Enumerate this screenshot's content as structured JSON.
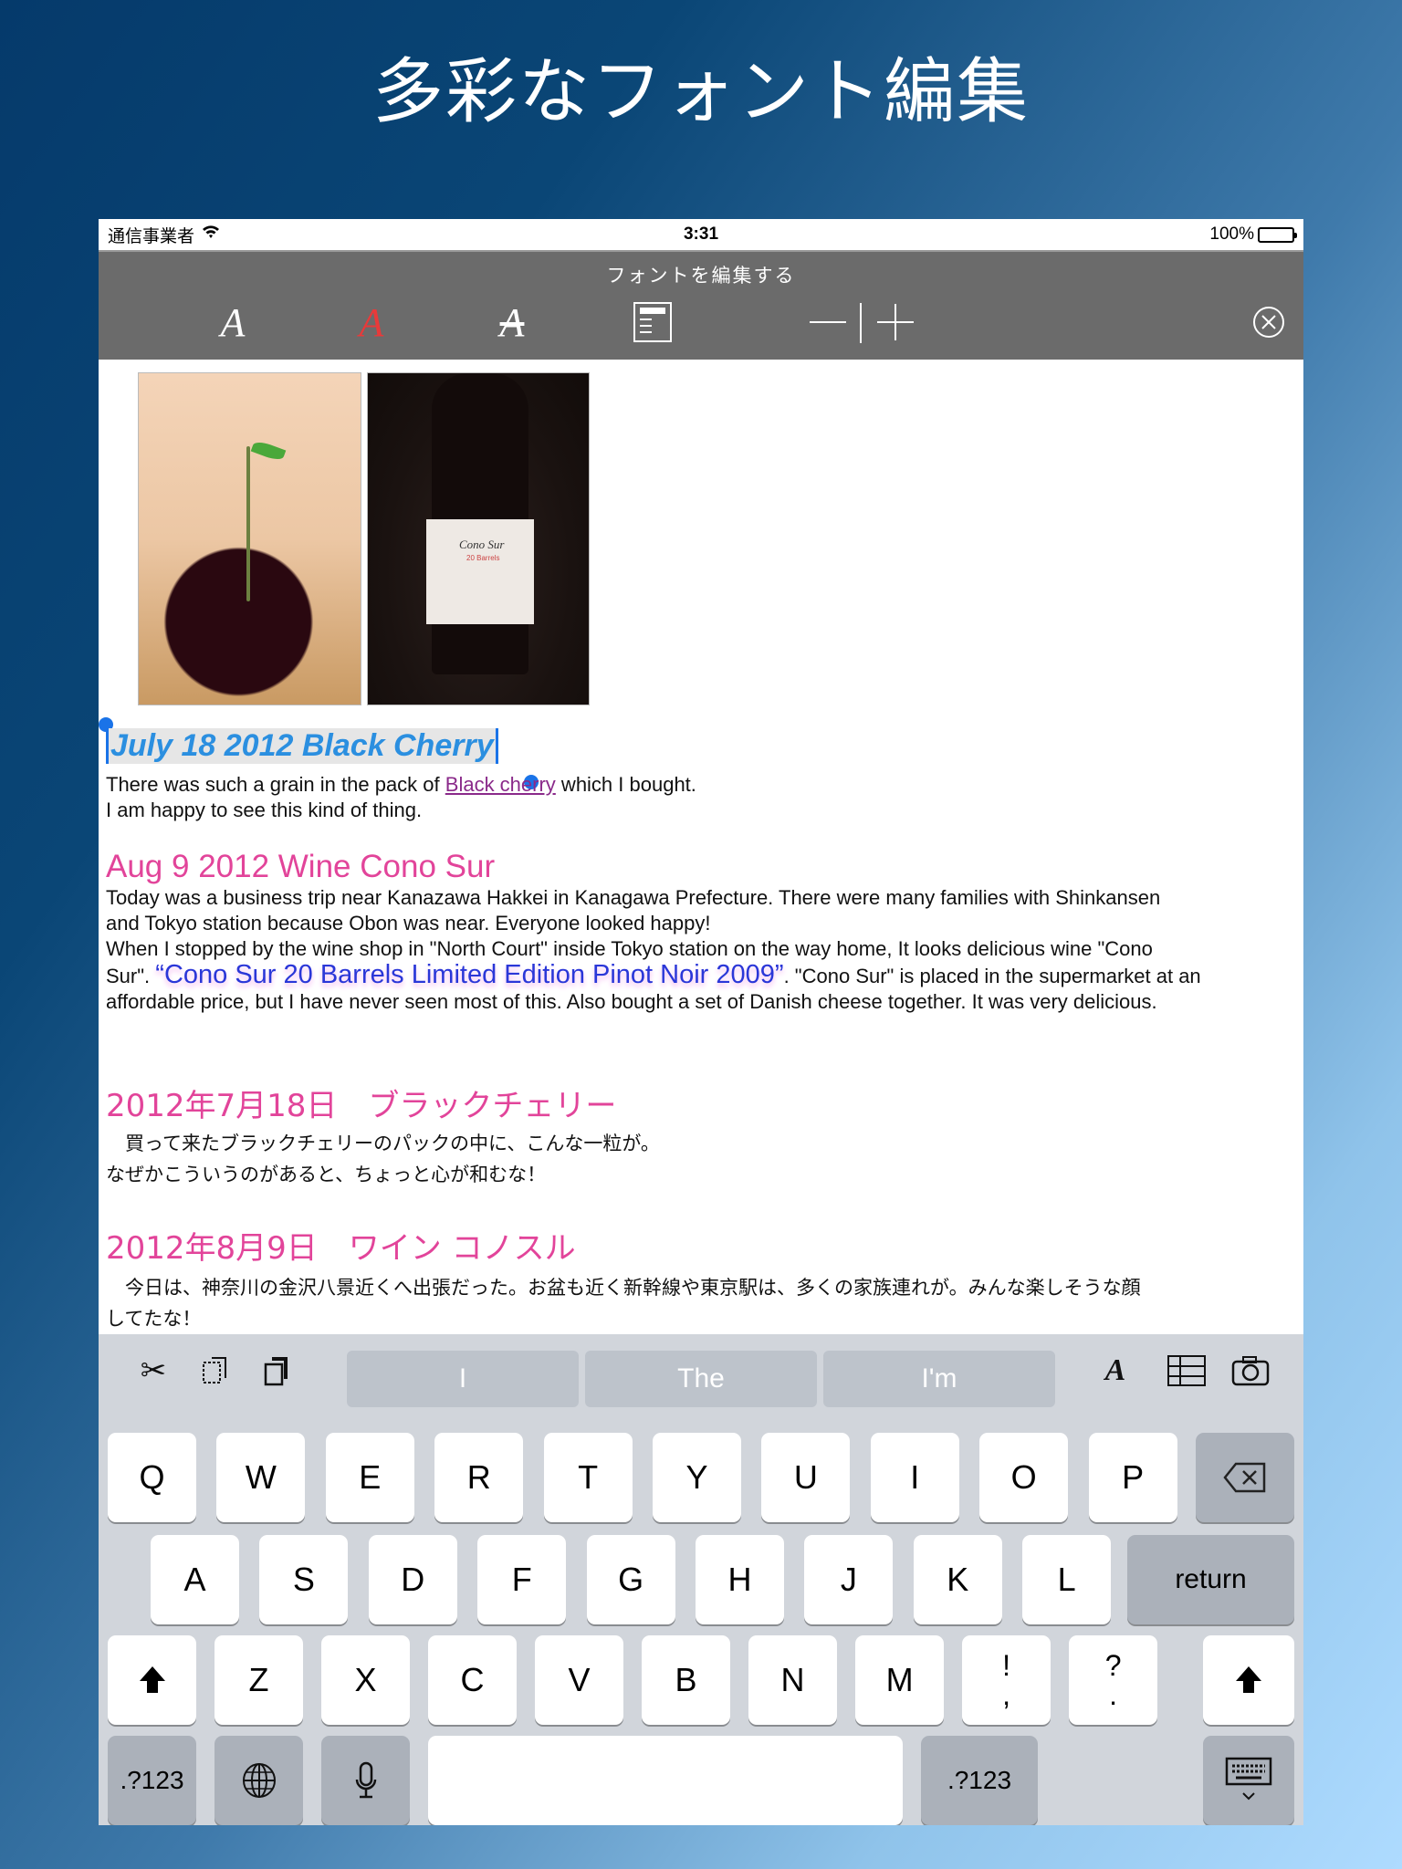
{
  "headline": "多彩なフォント編集",
  "status_bar": {
    "carrier": "通信事業者",
    "time": "3:31",
    "battery": "100%",
    "icons": [
      "wifi-icon",
      "battery-icon"
    ]
  },
  "toolbar": {
    "title": "フォントを編集する",
    "buttons": [
      {
        "name": "font-style",
        "glyph": "A"
      },
      {
        "name": "font-color",
        "glyph": "A",
        "color": "#e83a3a"
      },
      {
        "name": "strikethrough",
        "glyph": "A"
      },
      {
        "name": "align",
        "glyph": "≣"
      },
      {
        "name": "decrease-size",
        "glyph": "—"
      },
      {
        "name": "increase-size",
        "glyph": "+"
      },
      {
        "name": "close",
        "glyph": "⊗"
      }
    ]
  },
  "content": {
    "entries": [
      {
        "heading": "July 18 2012   Black Cherry",
        "heading_color": "#2b8fe0",
        "body_before_link": " There was such a grain in the pack of ",
        "link": "Black cherry",
        "body_after_link": " which I bought.",
        "body_line2": "I am happy to see this kind of thing."
      },
      {
        "heading": "Aug 9 2012   Wine Cono Sur",
        "heading_color": "#e2449a",
        "line1": " Today was a business trip near Kanazawa Hakkei in Kanagawa Prefecture. There were many families with Shinkansen",
        "line2": "and Tokyo station because Obon was near. Everyone looked happy!",
        "line3": " When I stopped by the wine shop in \"North Court\" inside Tokyo station on the way home, It looks delicious wine \"Cono",
        "line4_pre": "Sur\". ",
        "highlight": "“Cono Sur 20 Barrels Limited Edition Pinot Noir 2009”",
        "highlight_color": "#2a37d8",
        "line4_post": ". \"Cono Sur\" is placed in the supermarket at an",
        "line5": "affordable price, but I have never seen most of this. Also bought a set of Danish cheese together. It was very delicious."
      },
      {
        "heading": "2012年7月18日　ブラックチェリー",
        "line1": "　買って来たブラックチェリーのパックの中に、こんな一粒が。",
        "line2": "なぜかこういうのがあると、ちょっと心が和むな！"
      },
      {
        "heading": "2012年8月9日　ワイン コノスル",
        "line1": "　今日は、神奈川の金沢八景近くへ出張だった。お盆も近く新幹線や東京駅は、多くの家族連れが。みんな楽しそうな顔",
        "line2": "してたな！"
      }
    ],
    "photos": [
      {
        "alt": "cherry-photo"
      },
      {
        "alt": "wine-bottle-photo",
        "label": "Cono Sur",
        "sublabel": "20 Barrels"
      }
    ]
  },
  "keyboard": {
    "shortcuts_left": [
      "scissors-icon",
      "copy-icon",
      "paste-icon"
    ],
    "suggestions": [
      "I",
      "The",
      "I'm"
    ],
    "shortcuts_right": [
      "font-icon",
      "table-icon",
      "camera-icon"
    ],
    "row1": [
      "Q",
      "W",
      "E",
      "R",
      "T",
      "Y",
      "U",
      "I",
      "O",
      "P"
    ],
    "row2": [
      "A",
      "S",
      "D",
      "F",
      "G",
      "H",
      "J",
      "K",
      "L"
    ],
    "row3": [
      "Z",
      "X",
      "C",
      "V",
      "B",
      "N",
      "M"
    ],
    "punct": [
      {
        "top": "!",
        "bottom": ","
      },
      {
        "top": "?",
        "bottom": "."
      }
    ],
    "return": "return",
    "numbers": ".?123"
  }
}
